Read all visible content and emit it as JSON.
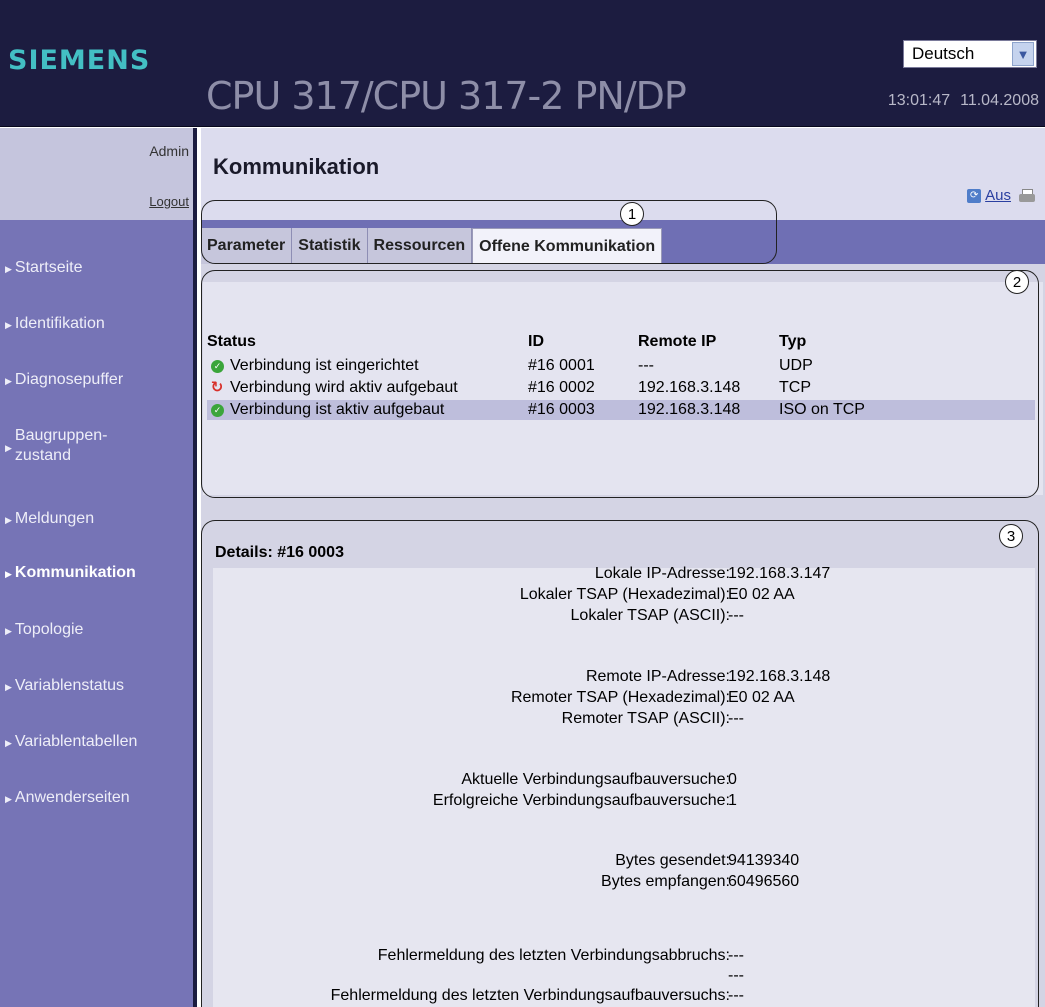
{
  "header": {
    "brand": "SIEMENS",
    "title": "CPU 317/CPU 317-2 PN/DP",
    "time": "13:01:47",
    "date": "11.04.2008",
    "language": "Deutsch"
  },
  "sidebar": {
    "user": "Admin",
    "logout": "Logout",
    "items": [
      {
        "label": "Startseite"
      },
      {
        "label": "Identifikation"
      },
      {
        "label": "Diagnosepuffer"
      },
      {
        "label": "Baugruppen-"
      },
      {
        "label": "Meldungen"
      },
      {
        "label": "Kommunikation"
      },
      {
        "label": "Topologie"
      },
      {
        "label": "Variablenstatus"
      },
      {
        "label": "Variablentabellen"
      },
      {
        "label": "Anwenderseiten"
      }
    ],
    "item_line2": "zustand",
    "active": "Kommunikation"
  },
  "main": {
    "title": "Kommunikation",
    "aus": "Aus",
    "tabs": [
      {
        "label": "Parameter"
      },
      {
        "label": "Statistik"
      },
      {
        "label": "Ressourcen"
      },
      {
        "label": "Offene Kommunikation"
      }
    ],
    "active_tab": "Offene Kommunikation",
    "callouts": [
      "1",
      "2",
      "3"
    ]
  },
  "connections": {
    "columns": [
      "Status",
      "ID",
      "Remote IP",
      "Typ"
    ],
    "rows": [
      {
        "icon": "ok",
        "status": "Verbindung ist eingerichtet",
        "id": "#16 0001",
        "ip": "---",
        "typ": "UDP"
      },
      {
        "icon": "busy",
        "status": "Verbindung wird aktiv aufgebaut",
        "id": "#16 0002",
        "ip": "192.168.3.148",
        "typ": "TCP"
      },
      {
        "icon": "ok",
        "status": "Verbindung ist aktiv aufgebaut",
        "id": "#16 0003",
        "ip": "192.168.3.148",
        "typ": "ISO on TCP"
      }
    ]
  },
  "details": {
    "title": "Details: #16 0003",
    "fields": [
      {
        "label": "Lokale IP-Adresse:",
        "value": "192.168.3.147"
      },
      {
        "label": "Lokaler TSAP (Hexadezimal):",
        "value": "E0 02 AA"
      },
      {
        "label": "Lokaler TSAP (ASCII):",
        "value": "---"
      },
      {
        "label": "Remote IP-Adresse:",
        "value": "192.168.3.148"
      },
      {
        "label": "Remoter TSAP (Hexadezimal):",
        "value": "E0 02 AA"
      },
      {
        "label": "Remoter TSAP (ASCII):",
        "value": "---"
      },
      {
        "label": "Aktuelle Verbindungsaufbauversuche:",
        "value": "0"
      },
      {
        "label": "Erfolgreiche Verbindungsaufbauversuche:",
        "value": "1"
      },
      {
        "label": "Bytes gesendet:",
        "value": "94139340"
      },
      {
        "label": "Bytes empfangen:",
        "value": "60496560"
      },
      {
        "label": "Fehlermeldung des letzten Verbindungsabbruchs:",
        "value": "---"
      },
      {
        "label": "Fehlermeldung des letzten Verbindungsaufbauversuchs:",
        "value": "---"
      }
    ],
    "extra_value": "---"
  }
}
